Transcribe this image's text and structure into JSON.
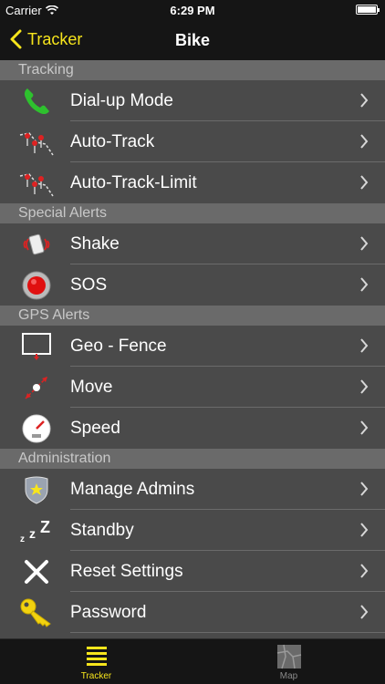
{
  "status": {
    "carrier": "Carrier",
    "time": "6:29 PM"
  },
  "nav": {
    "back_label": "Tracker",
    "title": "Bike"
  },
  "sections": {
    "tracking": {
      "header": "Tracking",
      "items": [
        {
          "label": "Dial-up Mode",
          "icon": "phone-icon"
        },
        {
          "label": "Auto-Track",
          "icon": "map-pins-icon"
        },
        {
          "label": "Auto-Track-Limit",
          "icon": "map-pins-icon"
        }
      ]
    },
    "special_alerts": {
      "header": "Special Alerts",
      "items": [
        {
          "label": "Shake",
          "icon": "shake-icon"
        },
        {
          "label": "SOS",
          "icon": "sos-button-icon"
        }
      ]
    },
    "gps_alerts": {
      "header": "GPS Alerts",
      "items": [
        {
          "label": "Geo - Fence",
          "icon": "geofence-icon"
        },
        {
          "label": "Move",
          "icon": "move-icon"
        },
        {
          "label": "Speed",
          "icon": "speedometer-icon"
        }
      ]
    },
    "administration": {
      "header": "Administration",
      "items": [
        {
          "label": "Manage Admins",
          "icon": "badge-icon"
        },
        {
          "label": "Standby",
          "icon": "sleep-icon"
        },
        {
          "label": "Reset Settings",
          "icon": "x-icon"
        },
        {
          "label": "Password",
          "icon": "key-icon"
        }
      ]
    }
  },
  "tabs": [
    {
      "label": "Tracker",
      "icon": "list-icon",
      "active": true
    },
    {
      "label": "Map",
      "icon": "map-icon",
      "active": false
    }
  ],
  "colors": {
    "accent": "#f7e51c",
    "bar": "#151515",
    "row_bg": "#4a4a4a",
    "section_bg": "#6a6a6a"
  }
}
